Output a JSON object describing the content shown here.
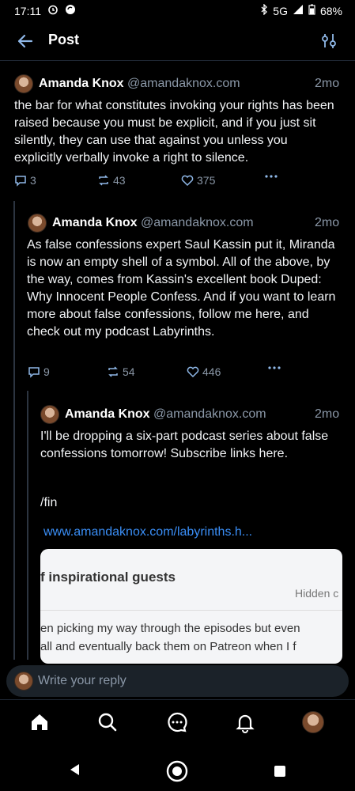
{
  "status": {
    "time": "17:11",
    "network": "5G",
    "battery": "68%"
  },
  "header": {
    "title": "Post"
  },
  "posts": [
    {
      "author": "Amanda Knox",
      "handle": "@amandaknox.com",
      "time": "2mo",
      "text": "the bar for what constitutes invoking your rights has been raised because you must be explicit, and if you just sit silently, they can use that against you unless you explicitly verbally invoke a right to silence.",
      "replies": "3",
      "reposts": "43",
      "likes": "375"
    },
    {
      "author": "Amanda Knox",
      "handle": "@amandaknox.com",
      "time": "2mo",
      "text": "As false confessions expert Saul Kassin put it, Miranda is now an empty shell of a symbol. All of the above, by the way, comes from Kassin's excellent book Duped: Why Innocent People Confess. And if you want to learn more about false confessions, follow me here, and check out my podcast Labyrinths.",
      "replies": "9",
      "reposts": "54",
      "likes": "446"
    },
    {
      "author": "Amanda Knox",
      "handle": "@amandaknox.com",
      "time": "2mo",
      "text": "I'll be dropping a six-part podcast series about false confessions tomorrow! Subscribe links here.",
      "text2": "/fin",
      "link": "www.amandaknox.com/labyrinths.h...",
      "card": {
        "heading": "f inspirational guests",
        "hidden": "Hidden c",
        "line1": "en picking my way through the episodes but even",
        "line2": " all and eventually back them on Patreon when I f"
      }
    }
  ],
  "reply": {
    "placeholder": "Write your reply"
  },
  "nav": [
    "home-icon",
    "search-icon",
    "chat-icon",
    "bell-icon",
    "profile-avatar"
  ],
  "colors": {
    "accent": "#3a8ef6",
    "muted": "#8b98a8",
    "background": "#000000"
  }
}
